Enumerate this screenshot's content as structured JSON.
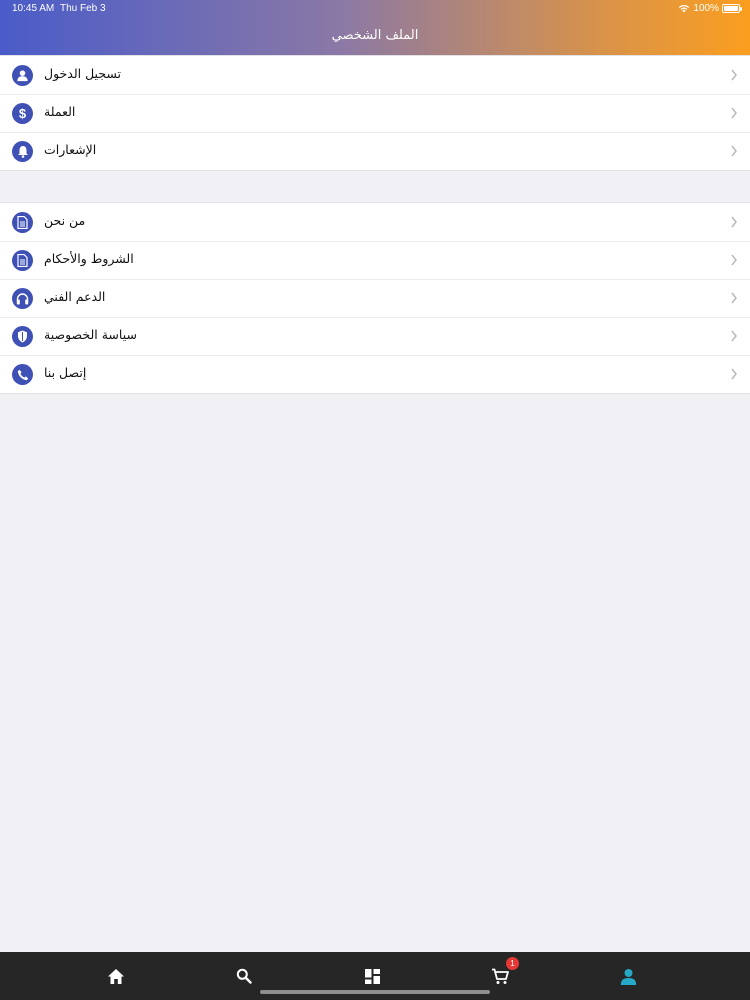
{
  "status_bar": {
    "time": "10:45 AM",
    "date": "Thu Feb 3",
    "battery": "100%"
  },
  "header": {
    "title": "الملف الشخصي"
  },
  "account_group": {
    "items": [
      {
        "label": "تسجيل الدخول",
        "icon": "user-icon"
      },
      {
        "label": "العملة",
        "icon": "dollar-icon"
      },
      {
        "label": "الإشعارات",
        "icon": "bell-icon"
      }
    ]
  },
  "info_group": {
    "items": [
      {
        "label": "من نحن",
        "icon": "document-icon"
      },
      {
        "label": "الشروط والأحكام",
        "icon": "document-icon"
      },
      {
        "label": "الدعم الفني",
        "icon": "headphones-icon"
      },
      {
        "label": "سياسة الخصوصية",
        "icon": "shield-icon"
      },
      {
        "label": "إتصل بنا",
        "icon": "phone-icon"
      }
    ]
  },
  "tab_bar": {
    "cart_badge": "1",
    "tabs": [
      "home-icon",
      "search-icon",
      "categories-icon",
      "cart-icon",
      "profile-icon"
    ],
    "active_color": "#26a8c7"
  },
  "colors": {
    "icon_bg": "#3f51b5",
    "header_start": "#4a5cc9",
    "header_end": "#fb9e1f"
  }
}
